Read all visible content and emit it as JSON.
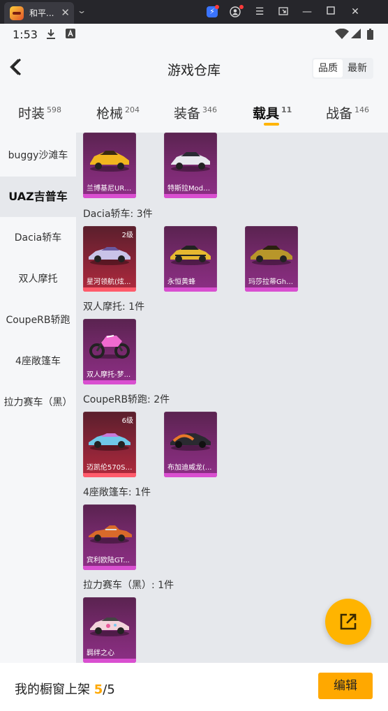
{
  "window": {
    "tab_title": "和平...",
    "tab_close": "✕",
    "tab_dropdown": "⌄"
  },
  "statusbar": {
    "time": "1:53"
  },
  "header": {
    "title": "游戏仓库",
    "sort": [
      {
        "label": "品质",
        "active": true
      },
      {
        "label": "最新",
        "active": false
      }
    ]
  },
  "tabs": [
    {
      "label": "时装",
      "count": "598"
    },
    {
      "label": "枪械",
      "count": "204"
    },
    {
      "label": "装备",
      "count": "346"
    },
    {
      "label": "载具",
      "count": "11",
      "active": true
    },
    {
      "label": "战备",
      "count": "146"
    }
  ],
  "sidebar": {
    "items": [
      {
        "label": "buggy沙滩车"
      },
      {
        "label": "UAZ吉普车",
        "active": true
      },
      {
        "label": "Dacia轿车"
      },
      {
        "label": "双人摩托"
      },
      {
        "label": "CoupeRB轿跑"
      },
      {
        "label": "4座敞篷车"
      },
      {
        "label": "拉力赛车（黑）"
      }
    ]
  },
  "sections": [
    {
      "title": "",
      "items": [
        {
          "name": "兰博基尼URU..."
        },
        {
          "name": "特斯拉Model..."
        }
      ]
    },
    {
      "title": "Dacia轿车: 3件",
      "items": [
        {
          "name": "星河领航(炫...",
          "level": "2级"
        },
        {
          "name": "永恒黄蜂"
        },
        {
          "name": "玛莎拉蒂Ghib..."
        }
      ]
    },
    {
      "title": "双人摩托: 1件",
      "items": [
        {
          "name": "双人摩托-梦..."
        }
      ]
    },
    {
      "title": "CoupeRB轿跑: 2件",
      "items": [
        {
          "name": "迈凯伦570S(...",
          "level": "6级"
        },
        {
          "name": "布加迪威龙(..."
        }
      ]
    },
    {
      "title": "4座敞篷车: 1件",
      "items": [
        {
          "name": "宾利欧陆GT..."
        }
      ]
    },
    {
      "title": "拉力赛车（黑）: 1件",
      "items": [
        {
          "name": "羁绊之心"
        }
      ]
    }
  ],
  "bottom": {
    "label": "我的橱窗上架",
    "current": "5",
    "total": "/5",
    "edit_label": "编辑"
  },
  "colors": {
    "accent": "#ffa800",
    "card_purple": "#7a2a70",
    "card_red": "#8a2437"
  }
}
